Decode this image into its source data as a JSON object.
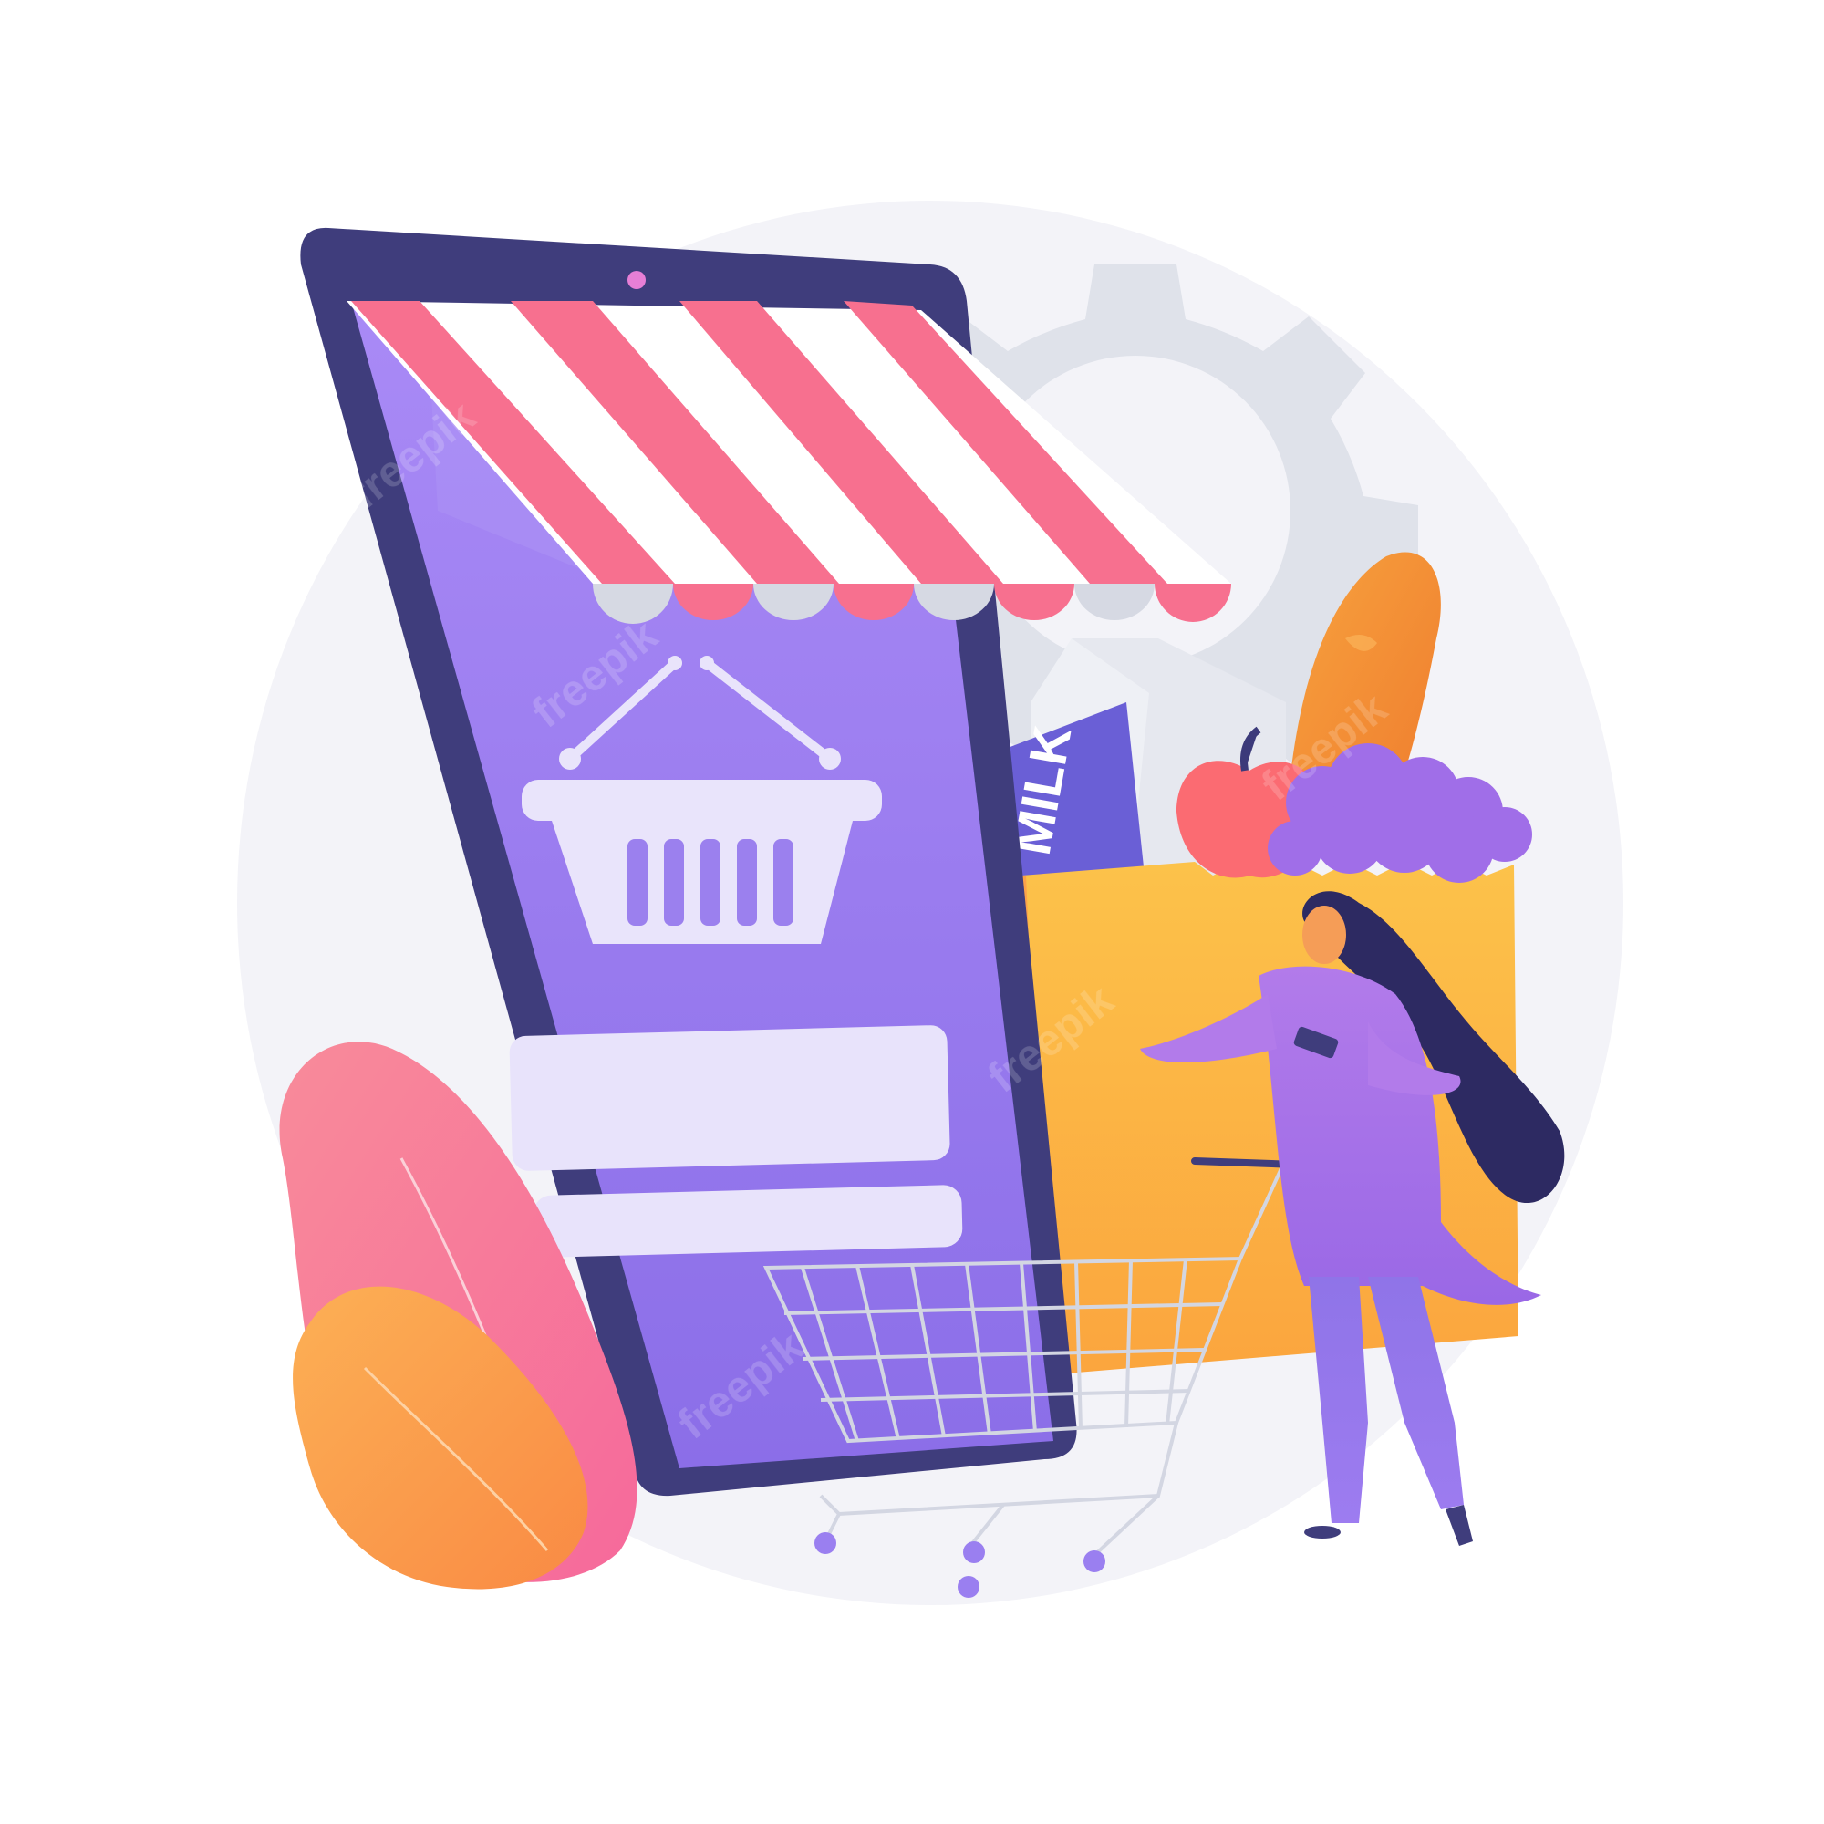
{
  "illustration": {
    "milk_carton_label": "MILK",
    "watermark_text": "freepik"
  },
  "colors": {
    "background": "#ffffff",
    "halo": "#f2f2f7",
    "tablet_frame": "#3f3d7c",
    "screen": "#9677ee",
    "screen_light": "#a68bf3",
    "awning_stripe": "#f7708f",
    "awning_white": "#ffffff",
    "awning_scallop_grey": "#d6d9e3",
    "basket": "#e9e4fb",
    "gear": "#dfe2ea",
    "milk_panel": "#6a5fd6",
    "bread": "#f28a33",
    "paper_bag": "#fbbd43",
    "apple": "#fb6b72",
    "grapes": "#a06ee8",
    "plant_pink": "#f8859b",
    "plant_orange": "#fb9a45",
    "cart": "#d7d9e4",
    "person_body": "#a973e8",
    "person_hair": "#2d2a62"
  }
}
